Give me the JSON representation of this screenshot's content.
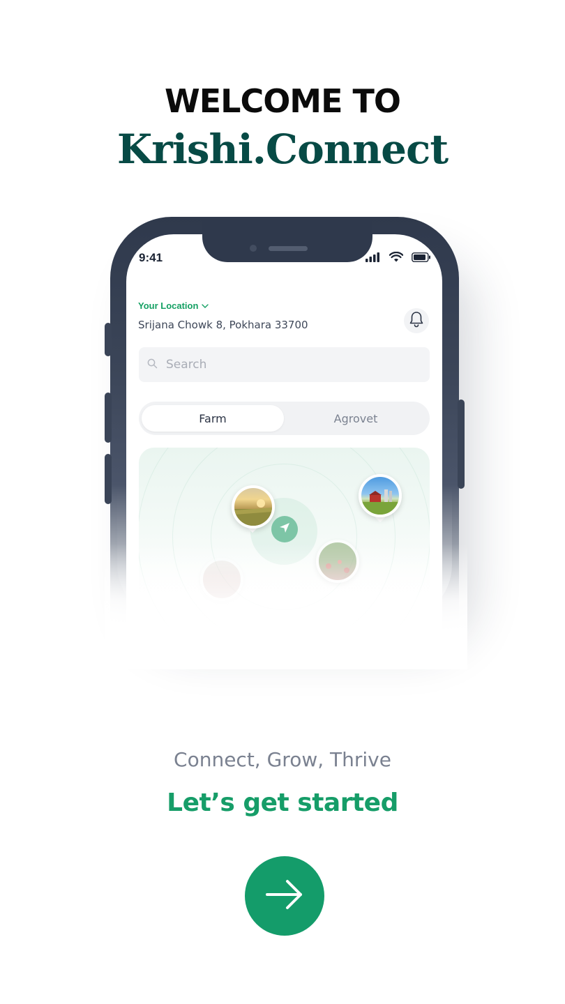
{
  "header": {
    "welcome": "WELCOME TO",
    "brand": "Krishi.Connect"
  },
  "phone": {
    "status_time": "9:41",
    "location_label": "Your Location",
    "address": "Srijana Chowk 8, Pokhara 33700",
    "search_placeholder": "Search",
    "tabs": [
      {
        "label": "Farm",
        "active": true
      },
      {
        "label": "Agrovet",
        "active": false
      }
    ]
  },
  "footer": {
    "tagline": "Connect, Grow, Thrive",
    "cta": "Let’s get started",
    "button_icon": "arrow-right-icon"
  },
  "colors": {
    "brand_dark": "#074a45",
    "accent_green": "#149c6a",
    "phone_frame": "#2f394c"
  }
}
